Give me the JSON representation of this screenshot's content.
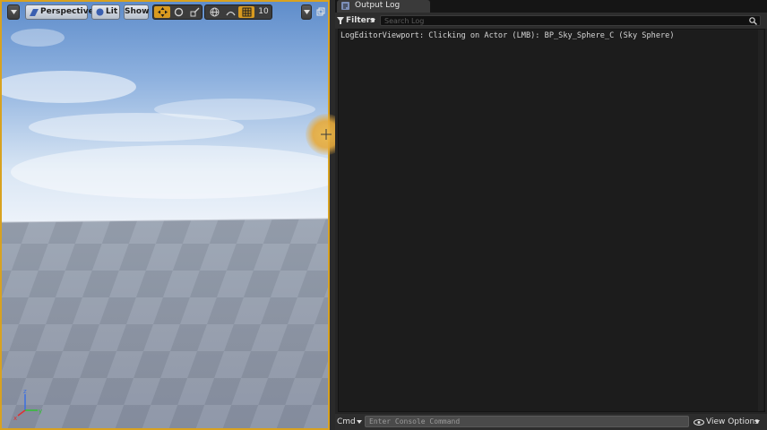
{
  "viewport": {
    "toolbar": {
      "view_mode": "Perspective",
      "lighting": "Lit",
      "show": "Show",
      "grid_snap_value": "10"
    }
  },
  "output_log": {
    "tab_title": "Output Log",
    "filters_label": "Filters",
    "search_placeholder": "Search Log",
    "lines": [
      "LogEditorViewport: Clicking on Actor (LMB): BP_Sky_Sphere_C (Sky Sphere)"
    ],
    "cmd_label": "Cmd",
    "console_placeholder": "Enter Console Command",
    "view_options_label": "View Options"
  },
  "colors": {
    "viewport_border": "#d8a220",
    "accent_gold": "#d89a1f",
    "panel_bg": "#242424"
  }
}
